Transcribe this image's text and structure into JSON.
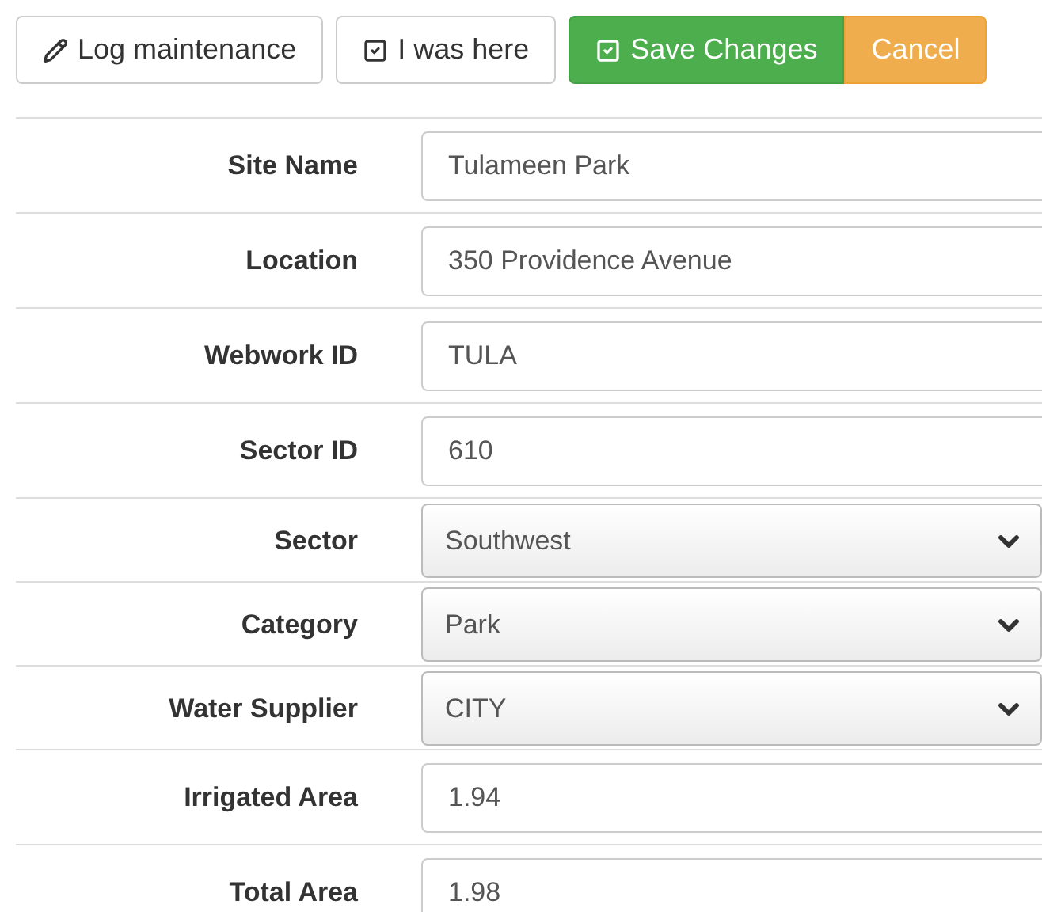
{
  "toolbar": {
    "buttons": [
      {
        "label": "Log maintenance",
        "kind": "default"
      },
      {
        "label": "I was here",
        "kind": "default"
      },
      {
        "label": "Save Changes",
        "kind": "success"
      },
      {
        "label": "Cancel",
        "kind": "warning"
      }
    ]
  },
  "form": {
    "fields": [
      {
        "label": "Site Name",
        "kind": "text",
        "value": "Tulameen Park"
      },
      {
        "label": "Location",
        "kind": "text",
        "value": "350 Providence Avenue"
      },
      {
        "label": "Webwork ID",
        "kind": "text",
        "value": "TULA"
      },
      {
        "label": "Sector ID",
        "kind": "text",
        "value": "610"
      },
      {
        "label": "Sector",
        "kind": "select",
        "value": "Southwest"
      },
      {
        "label": "Category",
        "kind": "select",
        "value": "Park"
      },
      {
        "label": "Water Supplier",
        "kind": "select",
        "value": "CITY"
      },
      {
        "label": "Irrigated Area",
        "kind": "text",
        "value": "1.94"
      },
      {
        "label": "Total Area",
        "kind": "text",
        "value": "1.98"
      }
    ]
  }
}
